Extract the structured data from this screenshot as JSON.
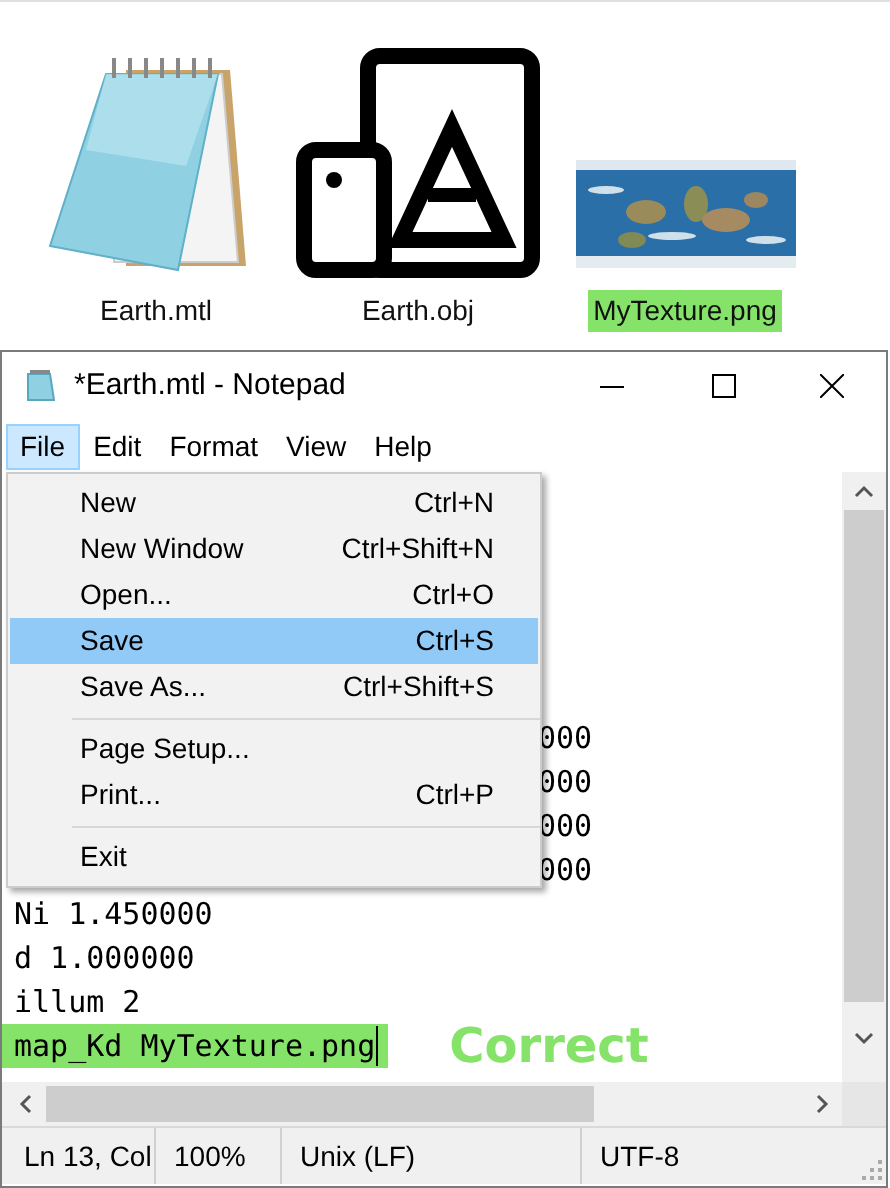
{
  "desktop": {
    "files": [
      {
        "label": "Earth.mtl",
        "kind": "notepad",
        "highlighted": false
      },
      {
        "label": "Earth.obj",
        "kind": "obj",
        "highlighted": false
      },
      {
        "label": "MyTexture.png",
        "kind": "picture",
        "highlighted": true
      }
    ]
  },
  "window": {
    "title": "*Earth.mtl - Notepad"
  },
  "menu_bar": [
    {
      "label": "File",
      "selected": true
    },
    {
      "label": "Edit",
      "selected": false
    },
    {
      "label": "Format",
      "selected": false
    },
    {
      "label": "View",
      "selected": false
    },
    {
      "label": "Help",
      "selected": false
    }
  ],
  "file_menu": [
    {
      "kind": "item",
      "label": "New",
      "shortcut": "Ctrl+N",
      "selected": false
    },
    {
      "kind": "item",
      "label": "New Window",
      "shortcut": "Ctrl+Shift+N",
      "selected": false
    },
    {
      "kind": "item",
      "label": "Open...",
      "shortcut": "Ctrl+O",
      "selected": false
    },
    {
      "kind": "item",
      "label": "Save",
      "shortcut": "Ctrl+S",
      "selected": true
    },
    {
      "kind": "item",
      "label": "Save As...",
      "shortcut": "Ctrl+Shift+S",
      "selected": false
    },
    {
      "kind": "separator"
    },
    {
      "kind": "item",
      "label": "Page Setup...",
      "selected": false
    },
    {
      "kind": "item",
      "label": "Print...",
      "shortcut": "Ctrl+P",
      "selected": false
    },
    {
      "kind": "separator"
    },
    {
      "kind": "item",
      "label": "Exit",
      "selected": false
    }
  ],
  "editor": {
    "lines": [
      {
        "kind": "covered",
        "text": "000"
      },
      {
        "kind": "covered",
        "text": "000"
      },
      {
        "kind": "covered",
        "text": "000"
      },
      {
        "kind": "covered",
        "text": "000"
      },
      {
        "kind": "plain",
        "text": "Ni 1.450000",
        "highlighted": false
      },
      {
        "kind": "plain",
        "text": "d 1.000000",
        "highlighted": false
      },
      {
        "kind": "plain",
        "text": "illum 2",
        "highlighted": false
      },
      {
        "kind": "plain",
        "text": "map_Kd MyTexture.png",
        "highlighted": true
      }
    ],
    "annotation": "Correct"
  },
  "status_bar": [
    "Ln 13, Col",
    "100%",
    "Unix (LF)",
    "UTF-8"
  ]
}
